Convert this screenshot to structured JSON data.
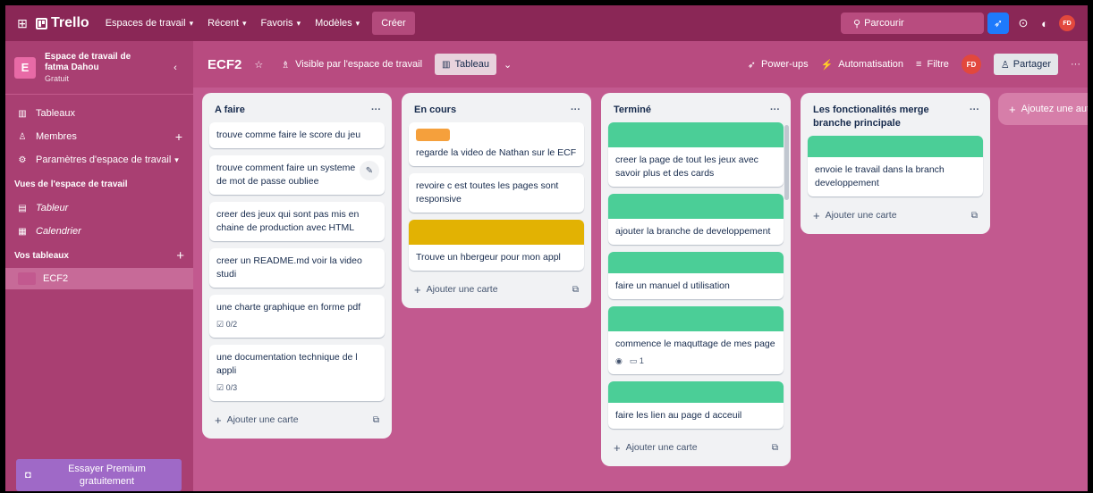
{
  "nav": {
    "brand": "Trello",
    "items": [
      {
        "label": "Espaces de travail"
      },
      {
        "label": "Récent"
      },
      {
        "label": "Favoris"
      },
      {
        "label": "Modèles"
      }
    ],
    "create_label": "Créer",
    "search_placeholder": "Parcourir",
    "user_initials": "FD"
  },
  "sidebar": {
    "workspace_badge": "E",
    "workspace_name_line1": "Espace de travail de",
    "workspace_name_line2": "fatma Dahou",
    "workspace_plan": "Gratuit",
    "items": [
      {
        "label": "Tableaux"
      },
      {
        "label": "Membres"
      },
      {
        "label": "Paramètres d'espace de travail"
      }
    ],
    "views_title": "Vues de l'espace de travail",
    "views": [
      {
        "label": "Tableur"
      },
      {
        "label": "Calendrier"
      }
    ],
    "boards_title": "Vos tableaux",
    "boards": [
      {
        "label": "ECF2"
      }
    ],
    "premium_line1": "Essayer Premium",
    "premium_line2": "gratuitement"
  },
  "board": {
    "title": "ECF2",
    "visibility": "Visible par l'espace de travail",
    "view": "Tableau",
    "powerups": "Power-ups",
    "automation": "Automatisation",
    "filter": "Filtre",
    "share": "Partager",
    "member_initials": "FD",
    "add_list": "Ajoutez une autre liste"
  },
  "lists": [
    {
      "title": "A faire",
      "add_card": "Ajouter une carte",
      "cards": [
        {
          "text": "trouve comme faire le score du jeu"
        },
        {
          "text": "trouve comment faire un systeme de mot de passe oubliee"
        },
        {
          "text": "creer des jeux qui sont pas mis en chaine de production avec HTML"
        },
        {
          "text": "creer un README.md voir la video studi"
        },
        {
          "text": "une charte graphique en forme pdf",
          "checklist": "0/2"
        },
        {
          "text": "une documentation technique de l appli",
          "checklist": "0/3"
        }
      ]
    },
    {
      "title": "En cours",
      "add_card": "Ajouter une carte",
      "cards": [
        {
          "text": "regarde la video de Nathan sur le ECF",
          "label_color": "#f5a03c"
        },
        {
          "text": "revoire c est toutes les pages sont responsive"
        },
        {
          "text": "Trouve un hbergeur pour mon appl",
          "cover_color": "#e2b203"
        }
      ]
    },
    {
      "title": "Terminé",
      "add_card": "Ajouter une carte",
      "cards": [
        {
          "text": "creer la page de tout les jeux avec savoir plus et des cards",
          "cover_color": "#4bce97"
        },
        {
          "text": "ajouter la branche de developpement",
          "cover_color": "#4bce97"
        },
        {
          "text": "faire un manuel d utilisation",
          "cover_color": "#4bce97"
        },
        {
          "text": "commence le maquttage de mes page",
          "cover_color": "#4bce97",
          "comments": "1"
        },
        {
          "text": "faire les lien au page d acceuil",
          "cover_color": "#4bce97"
        }
      ]
    },
    {
      "title": "Les fonctionalités merge branche principale",
      "add_card": "Ajouter une carte",
      "cards": [
        {
          "text": "envoie le travail dans la branch developpement",
          "cover_color": "#4bce97"
        }
      ]
    }
  ],
  "colors": {
    "board_bg": "#c2598f",
    "nav_bg": "#8a2756",
    "sidebar_bg": "#a93f72",
    "green_cover": "#4bce97",
    "yellow_cover": "#e2b203",
    "orange_label": "#f5a03c"
  }
}
